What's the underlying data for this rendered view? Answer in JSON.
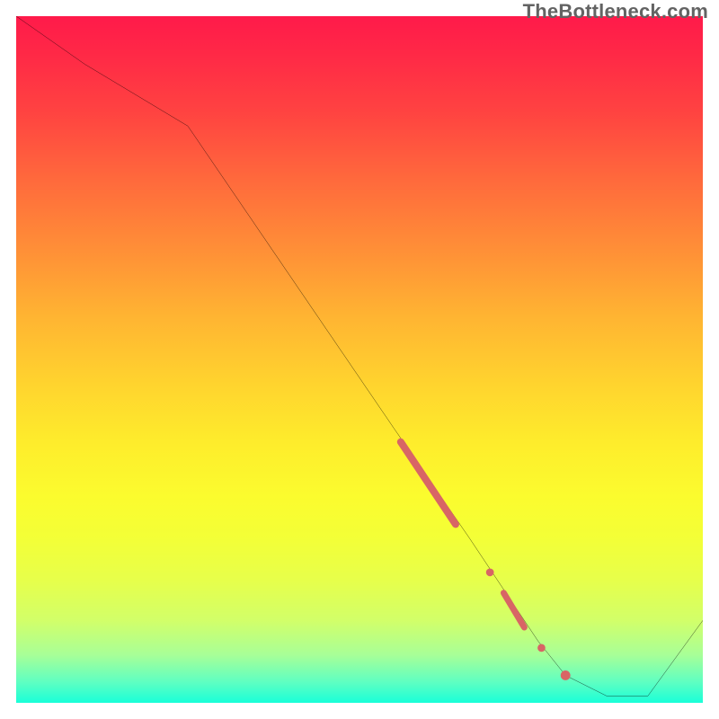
{
  "watermark": "TheBottleneck.com",
  "colors": {
    "curve": "#000000",
    "marker": "#d86565",
    "gradient_top": "#ff1a4a",
    "gradient_bottom": "#19ffd8"
  },
  "chart_data": {
    "type": "line",
    "title": "",
    "xlabel": "",
    "ylabel": "",
    "xlim": [
      0,
      100
    ],
    "ylim": [
      0,
      100
    ],
    "grid": false,
    "series": [
      {
        "name": "bottleneck-curve",
        "x": [
          0,
          10,
          25,
          40,
          55,
          66,
          72,
          76,
          80,
          86,
          92,
          100
        ],
        "values": [
          100,
          93,
          84,
          62,
          40,
          24,
          15,
          9,
          4,
          1,
          1,
          12
        ]
      }
    ],
    "markers": [
      {
        "name": "segment-thick",
        "kind": "segment",
        "x0": 56,
        "y0": 38,
        "x1": 64,
        "y1": 26,
        "width": 8
      },
      {
        "name": "dot-a",
        "kind": "dot",
        "x": 69,
        "y": 19,
        "r": 4
      },
      {
        "name": "segment-mid",
        "kind": "segment",
        "x0": 71,
        "y0": 16,
        "x1": 74,
        "y1": 11,
        "width": 7
      },
      {
        "name": "dot-b",
        "kind": "dot",
        "x": 76.5,
        "y": 8,
        "r": 4
      },
      {
        "name": "dot-c",
        "kind": "dot",
        "x": 80,
        "y": 4,
        "r": 5
      }
    ]
  }
}
